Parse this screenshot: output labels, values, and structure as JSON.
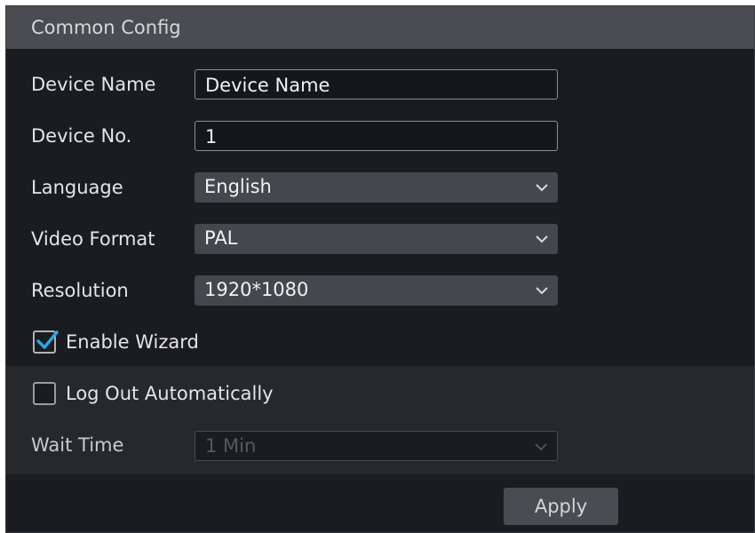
{
  "panel": {
    "title": "Common Config"
  },
  "form": {
    "device_name": {
      "label": "Device Name",
      "value": "Device Name"
    },
    "device_no": {
      "label": "Device No.",
      "value": "1"
    },
    "language": {
      "label": "Language",
      "value": "English"
    },
    "video_format": {
      "label": "Video Format",
      "value": "PAL"
    },
    "resolution": {
      "label": "Resolution",
      "value": "1920*1080"
    },
    "enable_wizard": {
      "label": "Enable Wizard",
      "checked": true
    },
    "log_out_automatically": {
      "label": "Log Out Automatically",
      "checked": false
    },
    "wait_time": {
      "label": "Wait Time",
      "value": "1 Min",
      "disabled": true
    }
  },
  "actions": {
    "apply_label": "Apply"
  },
  "colors": {
    "panel_bg": "#1b1c1f",
    "titlebar_bg": "#4a4c51",
    "select_bg": "#44474c",
    "checkmark": "#2aa7e0"
  },
  "icons": {
    "dropdown": "chevron-down-icon",
    "checkmark": "checkmark-icon"
  }
}
